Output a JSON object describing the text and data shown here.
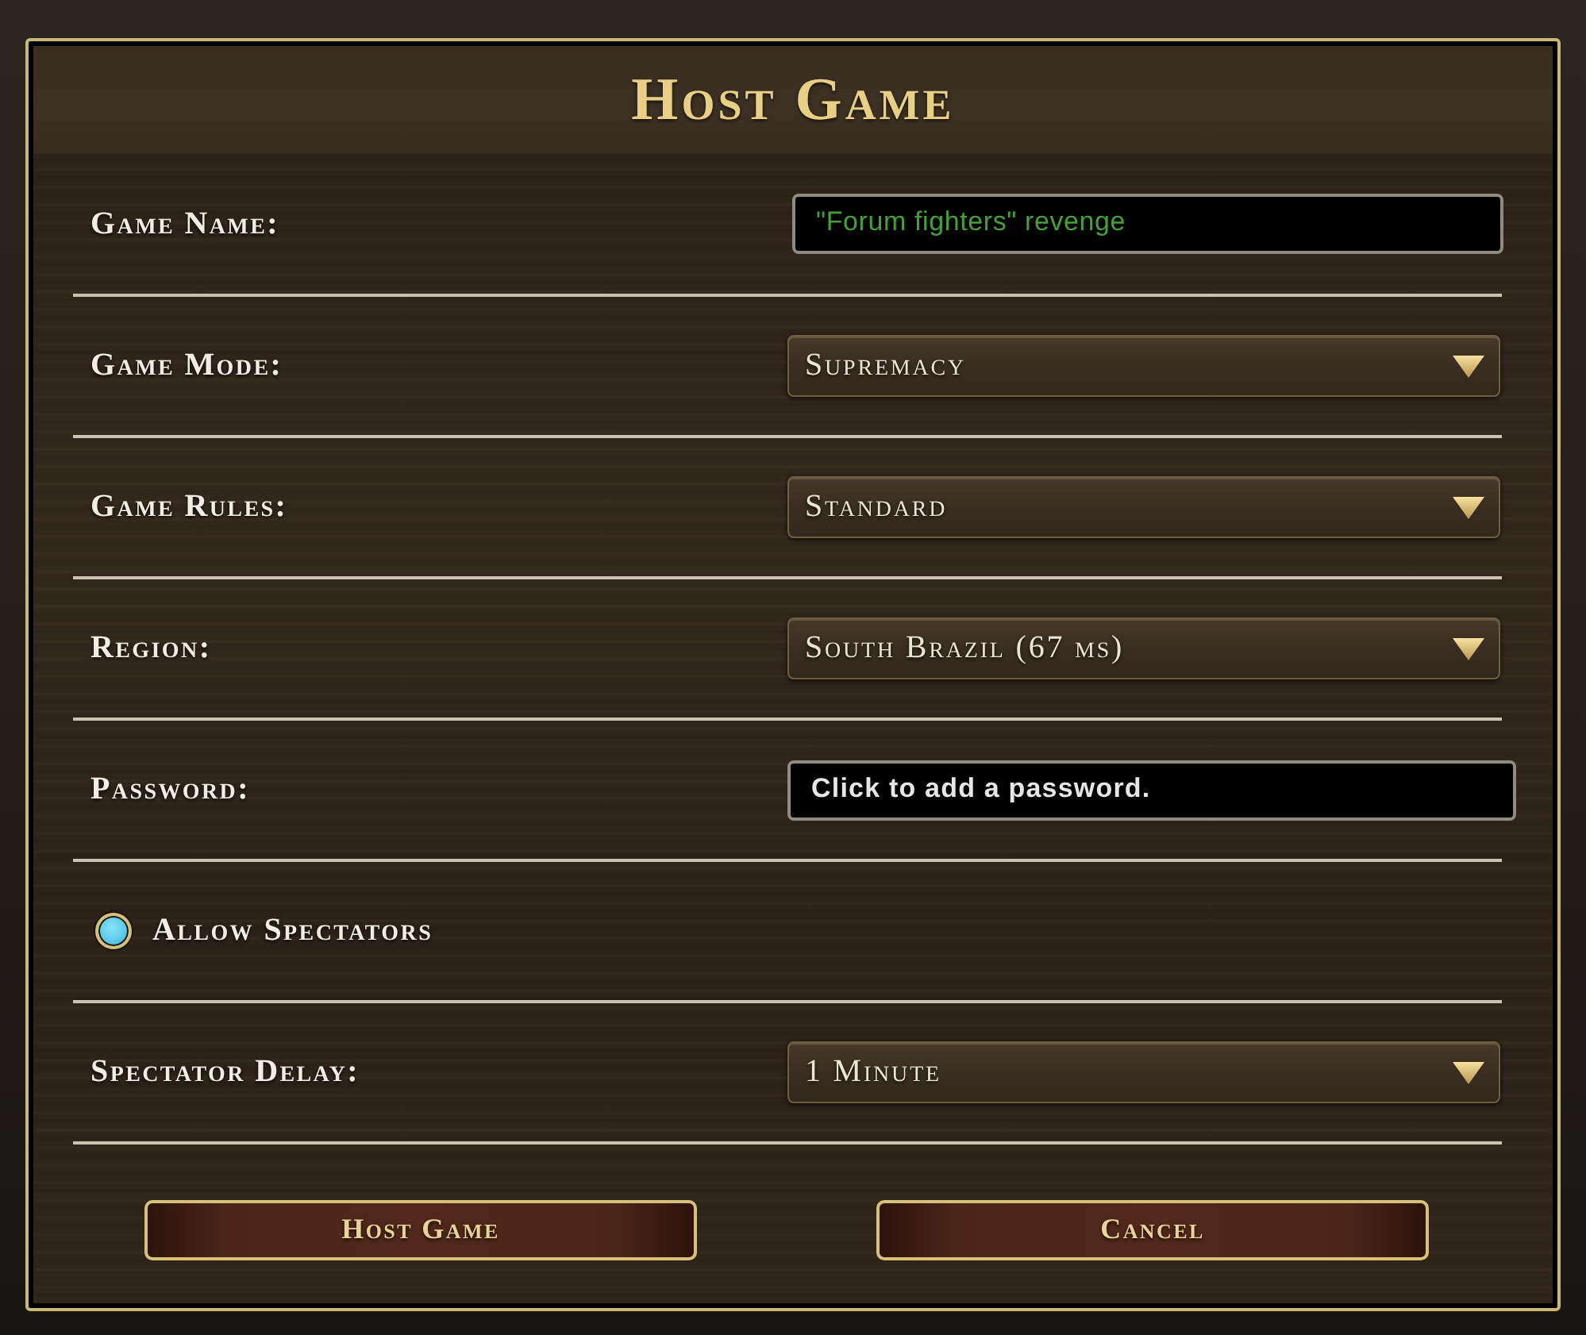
{
  "window": {
    "title": "Host Game"
  },
  "fields": [
    {
      "kind": "text",
      "label": "Game Name:",
      "value": "\"Forum fighters\" revenge"
    },
    {
      "kind": "dropdown",
      "label": "Game Mode:",
      "value": "Supremacy"
    },
    {
      "kind": "dropdown",
      "label": "Game Rules:",
      "value": "Standard"
    },
    {
      "kind": "dropdown",
      "label": "Region:",
      "value": "South Brazil (67 ms)"
    },
    {
      "kind": "password",
      "label": "Password:",
      "placeholder": "Click to add a password."
    },
    {
      "kind": "radio",
      "label": "Allow Spectators",
      "checked": true
    },
    {
      "kind": "dropdown",
      "label": "Spectator Delay:",
      "value": "1 Minute"
    }
  ],
  "buttons": [
    {
      "label": "Host Game"
    },
    {
      "label": "Cancel"
    }
  ]
}
